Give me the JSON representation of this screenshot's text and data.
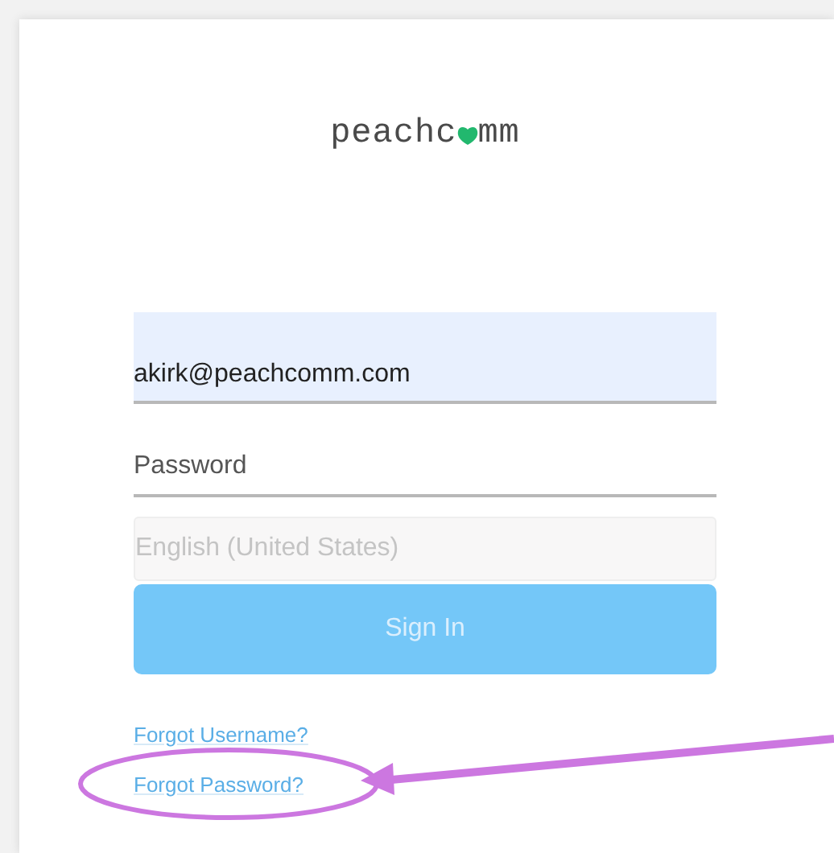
{
  "logo": {
    "text_before": "peachc",
    "text_after": "mm"
  },
  "email_field": {
    "value": "akirk@peachcomm.com"
  },
  "password_field": {
    "placeholder": "Password"
  },
  "language_select": {
    "value": "English (United States)",
    "disabled": true
  },
  "sign_in_button": {
    "label": "Sign In",
    "disabled": true
  },
  "links": [
    "Forgot Username?",
    "Forgot Password?"
  ]
}
